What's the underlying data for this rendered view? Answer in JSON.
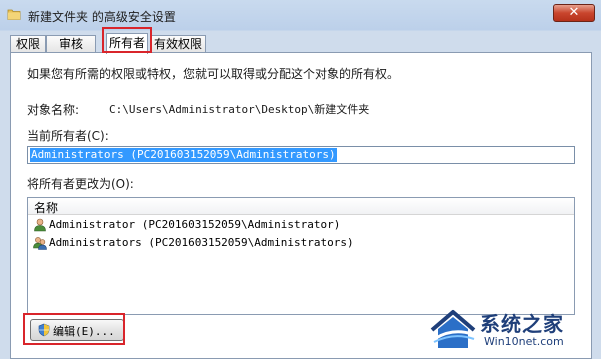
{
  "window": {
    "title": "新建文件夹 的高级安全设置",
    "close_label": "✕"
  },
  "tabs": [
    {
      "label": "权限",
      "active": false
    },
    {
      "label": "审核",
      "active": false
    },
    {
      "label": "所有者",
      "active": true
    },
    {
      "label": "有效权限",
      "active": false
    }
  ],
  "panel": {
    "intro": "如果您有所需的权限或特权，您就可以取得或分配这个对象的所有权。",
    "object_name_label": "对象名称:",
    "object_name_value": "C:\\Users\\Administrator\\Desktop\\新建文件夹",
    "current_owner_label": "当前所有者(C):",
    "current_owner_value": "Administrators (PC201603152059\\Administrators)",
    "change_owner_label": "将所有者更改为(O):",
    "list_header": "名称",
    "owners": [
      {
        "label": "Administrator (PC201603152059\\Administrator)",
        "icon": "user-icon"
      },
      {
        "label": "Administrators (PC201603152059\\Administrators)",
        "icon": "users-group-icon"
      }
    ],
    "edit_button": "编辑(E)..."
  },
  "watermark": {
    "name": "系统之家",
    "url": "Win10net.com"
  },
  "colors": {
    "highlight_red": "#d9252b",
    "selection_blue": "#3399ff",
    "title_bar": "#bcd0ea"
  }
}
